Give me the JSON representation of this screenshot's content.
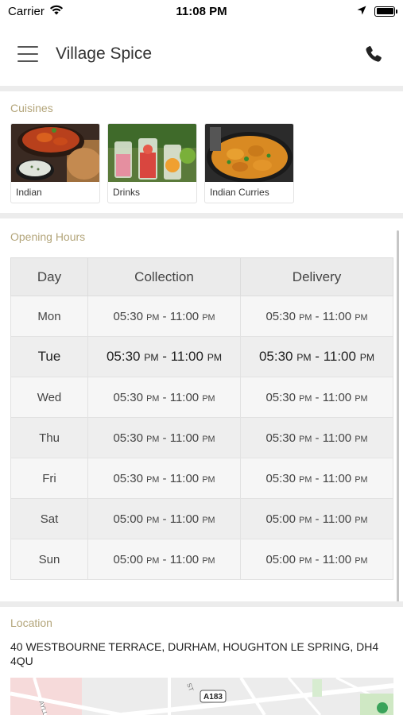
{
  "status_bar": {
    "carrier": "Carrier",
    "time": "11:08 PM"
  },
  "nav": {
    "title": "Village Spice",
    "menu_icon": "hamburger-menu-icon",
    "phone_icon": "phone-icon"
  },
  "cuisines": {
    "label": "Cuisines",
    "items": [
      {
        "label": "Indian"
      },
      {
        "label": "Drinks"
      },
      {
        "label": "Indian Curries"
      }
    ]
  },
  "opening_hours": {
    "label": "Opening Hours",
    "headers": [
      "Day",
      "Collection",
      "Delivery"
    ],
    "pm_suffix": "PM",
    "rows": [
      {
        "day": "Mon",
        "collection_start": "05:30",
        "collection_end": "11:00",
        "delivery_start": "05:30",
        "delivery_end": "11:00"
      },
      {
        "day": "Tue",
        "collection_start": "05:30",
        "collection_end": "11:00",
        "delivery_start": "05:30",
        "delivery_end": "11:00"
      },
      {
        "day": "Wed",
        "collection_start": "05:30",
        "collection_end": "11:00",
        "delivery_start": "05:30",
        "delivery_end": "11:00"
      },
      {
        "day": "Thu",
        "collection_start": "05:30",
        "collection_end": "11:00",
        "delivery_start": "05:30",
        "delivery_end": "11:00"
      },
      {
        "day": "Fri",
        "collection_start": "05:30",
        "collection_end": "11:00",
        "delivery_start": "05:30",
        "delivery_end": "11:00"
      },
      {
        "day": "Sat",
        "collection_start": "05:00",
        "collection_end": "11:00",
        "delivery_start": "05:00",
        "delivery_end": "11:00"
      },
      {
        "day": "Sun",
        "collection_start": "05:00",
        "collection_end": "11:00",
        "delivery_start": "05:00",
        "delivery_end": "11:00"
      }
    ]
  },
  "location": {
    "label": "Location",
    "address": "40 WESTBOURNE TERRACE, DURHAM, HOUGHTON LE SPRING, DH4 4QU",
    "map_road_label": "A183"
  },
  "colors": {
    "section_label": "#b3a57a",
    "divider": "#ececec",
    "table_header": "#ebebeb"
  }
}
